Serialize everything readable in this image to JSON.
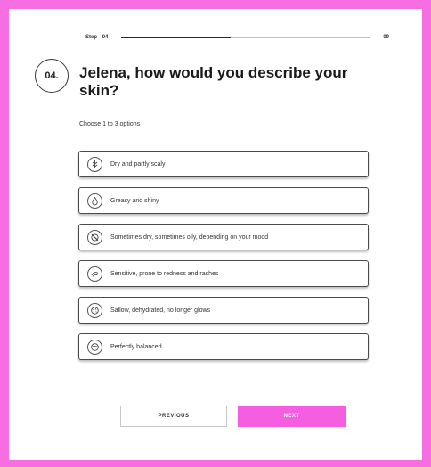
{
  "progress": {
    "step_word": "Step",
    "current": "04",
    "total": "09",
    "fraction": 0.44
  },
  "question": {
    "number": "04.",
    "title": "Jelena, how would you describe your skin?",
    "hint": "Choose 1 to 3 options"
  },
  "options": [
    {
      "label": "Dry and partly scaly",
      "icon": "dry-skin-icon"
    },
    {
      "label": "Greasy and shiny",
      "icon": "oil-drop-icon"
    },
    {
      "label": "Sometimes dry, sometimes oily, depending on your mood",
      "icon": "combination-skin-icon"
    },
    {
      "label": "Sensitive, prone to redness and rashes",
      "icon": "sensitive-skin-icon"
    },
    {
      "label": "Sallow, dehydrated, no longer glows",
      "icon": "dull-skin-icon"
    },
    {
      "label": "Perfectly balanced",
      "icon": "balanced-skin-icon"
    }
  ],
  "buttons": {
    "previous": "PREVIOUS",
    "next": "NEXT"
  },
  "colors": {
    "background": "#f76ee3",
    "accent": "#f55ee0"
  }
}
